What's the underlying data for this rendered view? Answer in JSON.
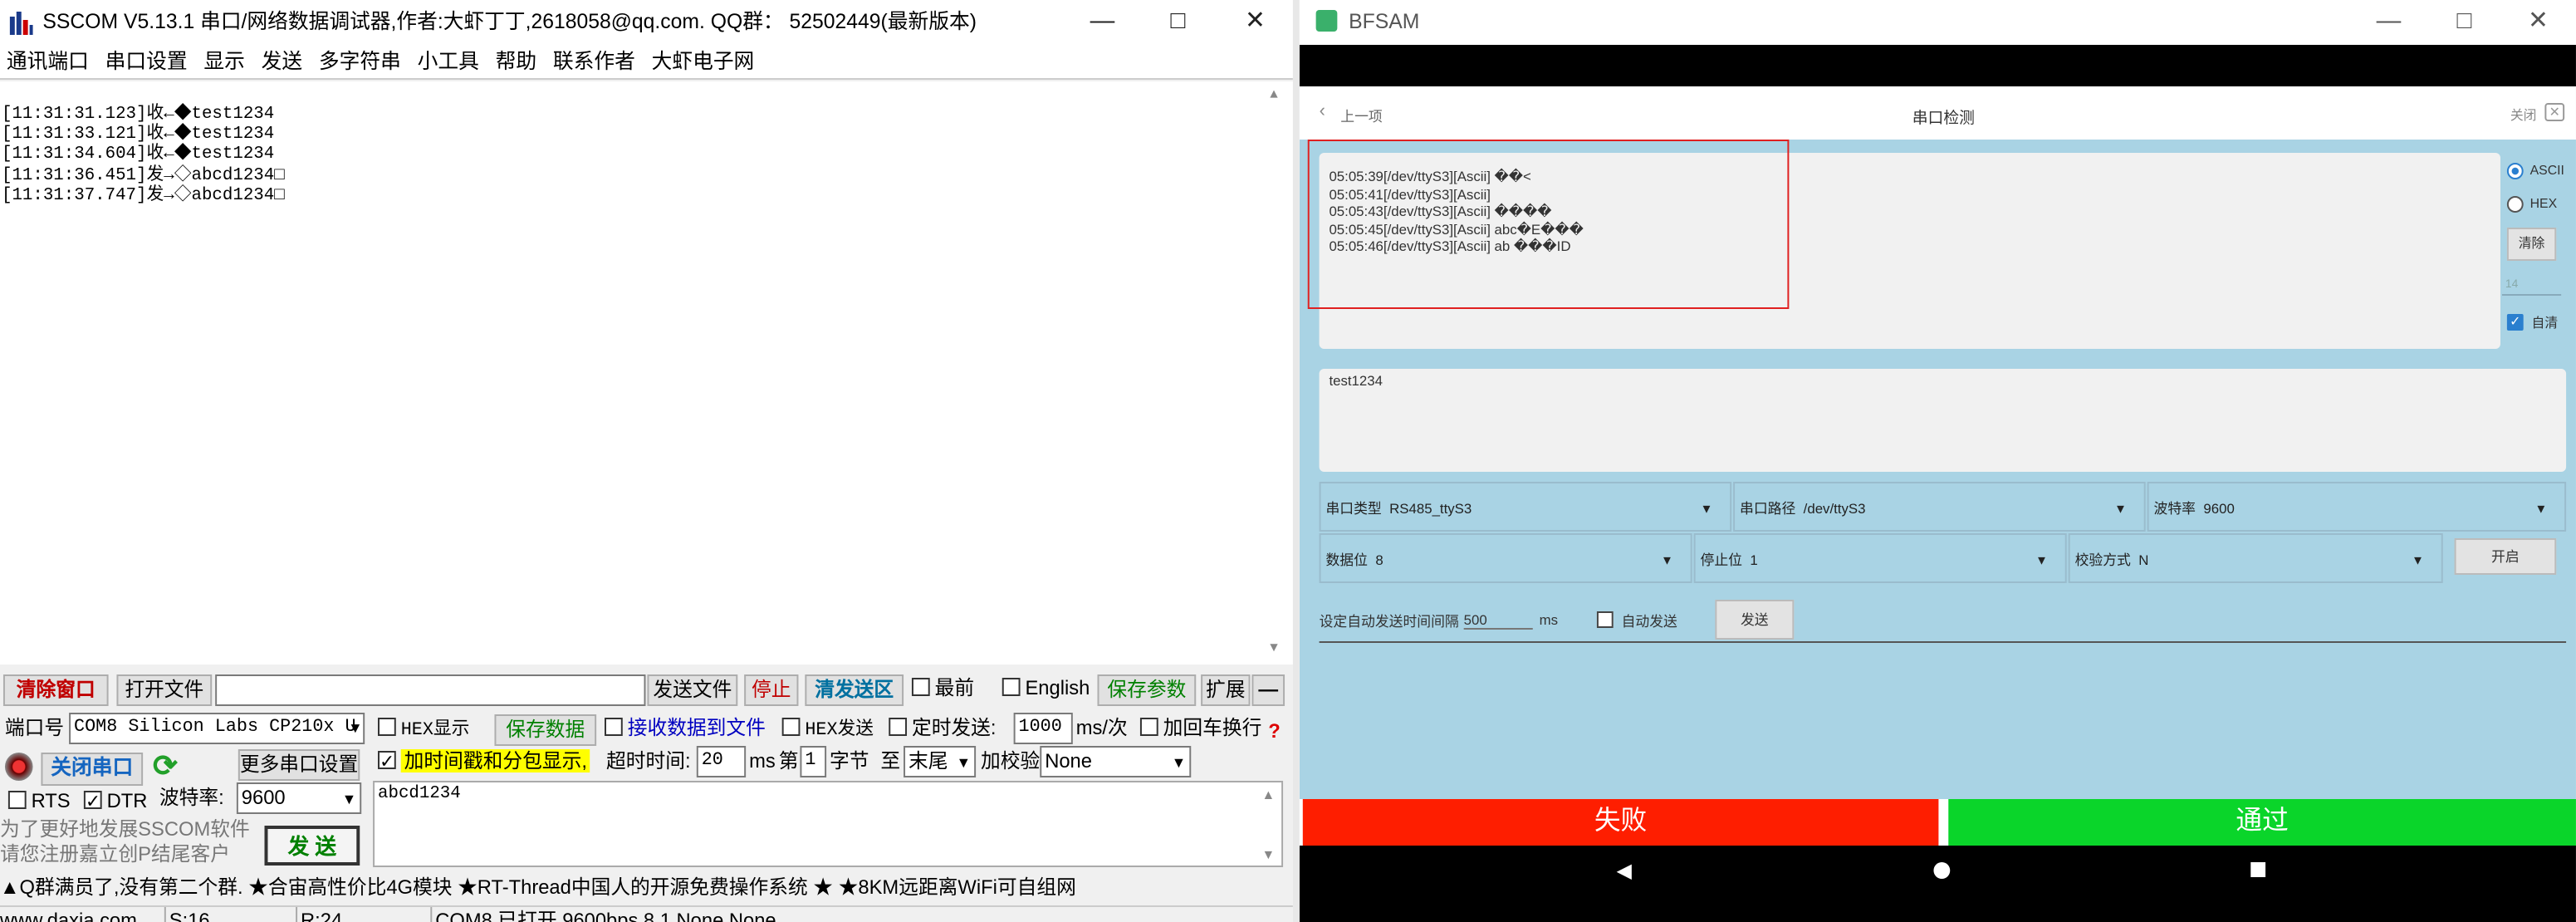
{
  "sscom": {
    "title": "SSCOM V5.13.1 串口/网络数据调试器,作者:大虾丁丁,2618058@qq.com. QQ群： 52502449(最新版本)",
    "menu": [
      "通讯端口",
      "串口设置",
      "显示",
      "发送",
      "多字符串",
      "小工具",
      "帮助",
      "联系作者",
      "大虾电子网"
    ],
    "log": [
      "[11:31:31.123]收←◆test1234",
      "[11:31:33.121]收←◆test1234",
      "[11:31:34.604]收←◆test1234",
      "[11:31:36.451]发→◇abcd1234□",
      "[11:31:37.747]发→◇abcd1234□"
    ],
    "toolbar": {
      "clear_window": "清除窗口",
      "open_file": "打开文件",
      "send_file": "发送文件",
      "stop": "停止",
      "clear_send": "清发送区",
      "topmost": "最前",
      "english": "English",
      "save_params": "保存参数",
      "expand": "扩展",
      "minus": "—"
    },
    "port": {
      "port_label": "端口号",
      "port_value": "COM8 Silicon Labs CP210x U",
      "hex_display": "HEX显示",
      "save_data": "保存数据",
      "recv_to_file": "接收数据到文件",
      "hex_send": "HEX发送",
      "timed_send": "定时发送:",
      "interval": "1000",
      "interval_unit": "ms/次",
      "append_crlf": "加回车换行",
      "close_port": "关闭串口",
      "more_settings": "更多串口设置",
      "timestamp_split": "加时间戳和分包显示,",
      "timeout_label": "超时时间:",
      "timeout_value": "20",
      "timeout_unit": "ms",
      "nth_label": "第",
      "nth_value": "1",
      "byte_label": "字节",
      "to_label": "至",
      "end_value": "末尾",
      "checksum_label": "加校验",
      "checksum_value": "None",
      "rts": "RTS",
      "dtr": "DTR",
      "baud_label": "波特率:",
      "baud_value": "9600",
      "send_text": "abcd1234",
      "send_button": "发  送",
      "promo1": "为了更好地发展SSCOM软件",
      "promo2": "请您注册嘉立创P结尾客户"
    },
    "ticker": "▲Q群满员了,没有第二个群. ★合宙高性价比4G模块 ★RT-Thread中国人的开源免费操作系统 ★ ★8KM远距离WiFi可自组网",
    "status": {
      "website": "www.daxia.com",
      "sent": "S:16",
      "received": "R:24",
      "port_state": "COM8 已打开  9600bps,8,1,None,None"
    }
  },
  "bfsam": {
    "title": "BFSAM",
    "back": "上一项",
    "page_title": "串口检测",
    "close": "关闭",
    "log": [
      "05:05:39[/dev/ttyS3][Ascii] ��<",
      "05:05:41[/dev/ttyS3][Ascii]",
      "05:05:43[/dev/ttyS3][Ascii] ����",
      "05:05:45[/dev/ttyS3][Ascii] abc�E���",
      "05:05:46[/dev/ttyS3][Ascii] ab ���ID"
    ],
    "mode_ascii": "ASCII",
    "mode_hex": "HEX",
    "clear": "清除",
    "count": "14",
    "auto_clear": "自清",
    "send_text": "test1234",
    "serial_type_label": "串口类型",
    "serial_type_value": "RS485_ttyS3",
    "serial_path_label": "串口路径",
    "serial_path_value": "/dev/ttyS3",
    "baud_label": "波特率",
    "baud_value": "9600",
    "data_bits_label": "数据位",
    "data_bits_value": "8",
    "stop_bits_label": "停止位",
    "stop_bits_value": "1",
    "parity_label": "校验方式",
    "parity_value": "N",
    "open": "开启",
    "auto_interval_label": "设定自动发送时间间隔",
    "auto_interval_value": "500",
    "auto_interval_unit": "ms",
    "auto_send": "自动发送",
    "send": "发送",
    "fail": "失败",
    "pass": "通过",
    "colors": {
      "fail": "#fe1e00",
      "pass": "#0ad52a",
      "panel": "#a9d3e4"
    }
  }
}
